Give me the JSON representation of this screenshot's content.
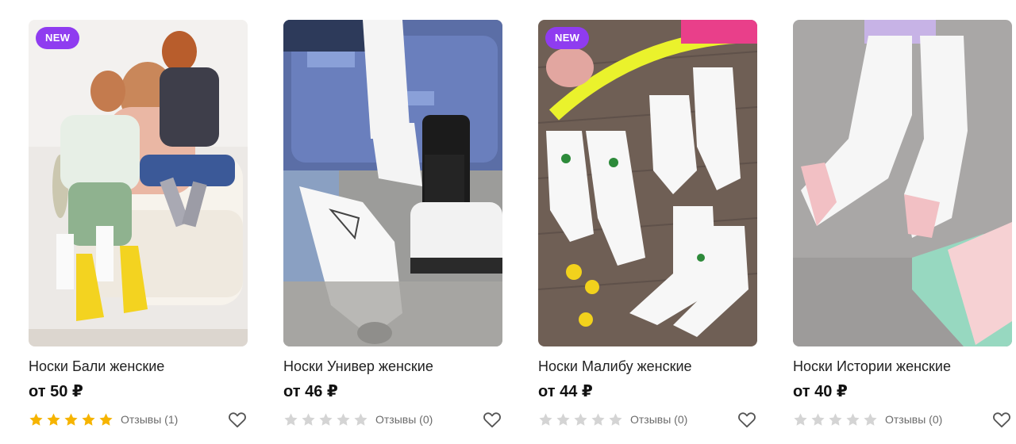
{
  "products": [
    {
      "title": "Носки Бали женские",
      "price": "от 50 ₽",
      "badge": "NEW",
      "rating": 5,
      "reviews": "Отзывы (1)",
      "image": "mother-and-children-in-yellow-socks"
    },
    {
      "title": "Носки Универ женские",
      "price": "от 46 ₽",
      "badge": "",
      "rating": 0,
      "reviews": "Отзывы (0)",
      "image": "white-socks-on-suitcase-and-boot"
    },
    {
      "title": "Носки Малибу женские",
      "price": "от 44 ₽",
      "badge": "NEW",
      "rating": 0,
      "reviews": "Отзывы (0)",
      "image": "white-socks-flatlay-on-wood"
    },
    {
      "title": "Носки Истории женские",
      "price": "от 40 ₽",
      "badge": "",
      "rating": 0,
      "reviews": "Отзывы (0)",
      "image": "ankle-socks-pink-heel"
    }
  ],
  "colors": {
    "badge": "#8f3cf0",
    "star_filled": "#f6b400",
    "star_empty": "#d4d4d4",
    "heart_outline": "#555555"
  },
  "icons": {
    "star": "star-icon",
    "favorite": "heart-icon"
  }
}
